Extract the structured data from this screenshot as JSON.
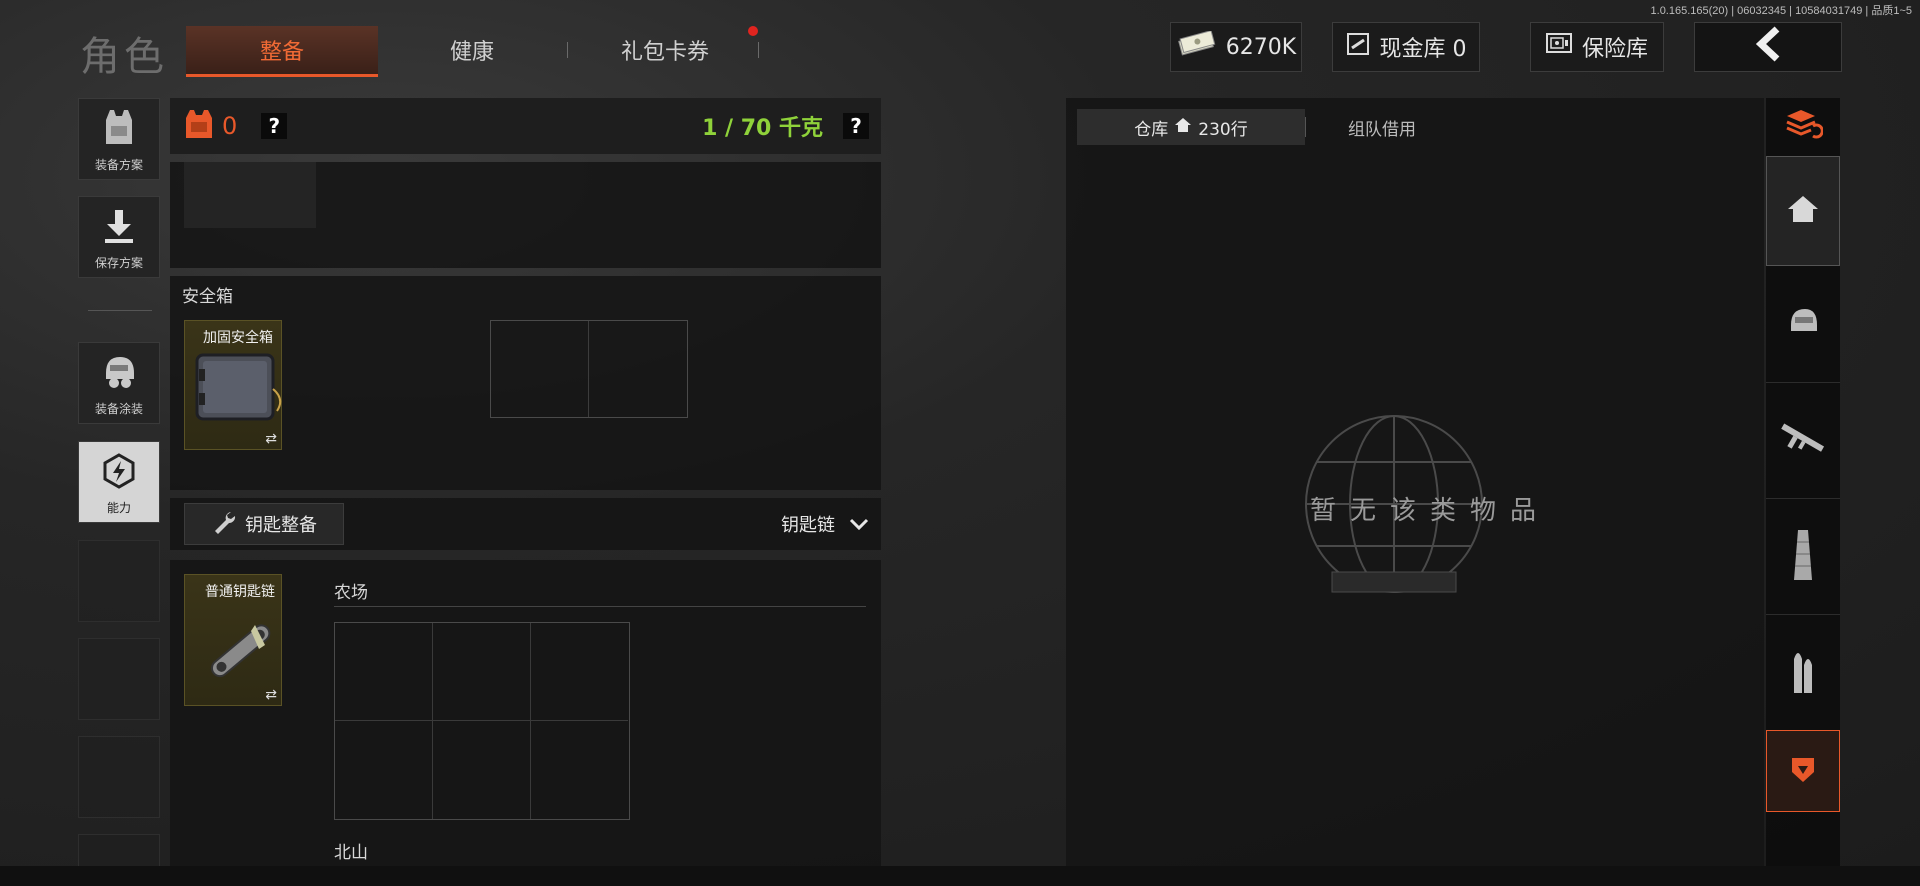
{
  "header": {
    "title": "角色",
    "tabs": [
      {
        "label": "整备",
        "active": true
      },
      {
        "label": "健康",
        "active": false
      },
      {
        "label": "礼包卡券",
        "active": false,
        "notification": true
      }
    ],
    "version": "1.0.165.165(20) | 06032345 | 10584031749 | 品质1~5",
    "money": "6270K",
    "cash_vault": "现金库 0",
    "safe_vault": "保险库"
  },
  "left_menu": [
    {
      "label": "装备方案",
      "icon": "vest-icon"
    },
    {
      "label": "保存方案",
      "icon": "download-icon"
    },
    {
      "label": "装备涂装",
      "icon": "helmet-icon"
    },
    {
      "label": "能力",
      "icon": "ability-icon",
      "active": true
    }
  ],
  "loadout": {
    "armor_count": "0",
    "weight": "1 / 70 千克",
    "safe_box_title": "安全箱",
    "safe_box_item": "加固安全箱",
    "key_button": "钥匙整备",
    "key_dropdown": "钥匙链",
    "key_item": "普通钥匙链",
    "map1": "农场",
    "map2": "北山"
  },
  "warehouse": {
    "tab1_label": "仓库",
    "tab1_rows": "230行",
    "tab2_label": "组队借用",
    "empty_text": "暂无该类物品"
  },
  "colors": {
    "accent": "#e8582a",
    "weight_green": "#8fd23a",
    "notification": "#e0241f"
  }
}
